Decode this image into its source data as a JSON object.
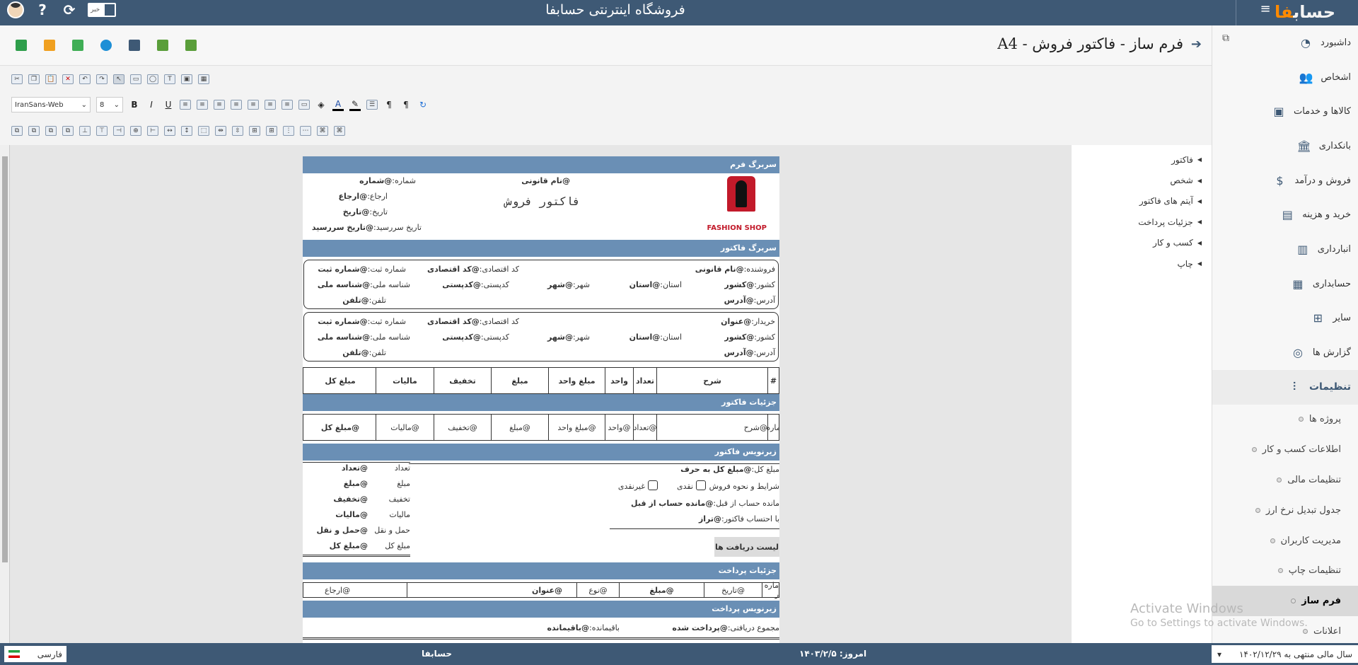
{
  "topbar": {
    "title": "فروشگاه اینترنتی حسابفا",
    "logo": "حساب",
    "logo_accent": "فا",
    "news_label": "خبر"
  },
  "sidebar": {
    "items": [
      {
        "label": "داشبورد",
        "icon": "gauge-icon"
      },
      {
        "label": "اشخاص",
        "icon": "people-icon"
      },
      {
        "label": "کالاها و خدمات",
        "icon": "box-icon"
      },
      {
        "label": "بانکداری",
        "icon": "bank-icon"
      },
      {
        "label": "فروش و درآمد",
        "icon": "sales-icon"
      },
      {
        "label": "خرید و هزینه",
        "icon": "cart-icon"
      },
      {
        "label": "انبارداری",
        "icon": "warehouse-icon"
      },
      {
        "label": "حسابداری",
        "icon": "ledger-icon"
      },
      {
        "label": "سایر",
        "icon": "grid-icon"
      },
      {
        "label": "گزارش ها",
        "icon": "report-icon"
      }
    ],
    "settings_label": "تنظیمات",
    "sub_items": [
      "پروژه ها",
      "اطلاعات کسب و کار",
      "تنظیمات مالی",
      "جدول تبدیل نرخ ارز",
      "مدیریت کاربران",
      "تنظیمات چاپ",
      "فرم ساز",
      "اعلانات"
    ],
    "active_sub": "فرم ساز"
  },
  "page": {
    "title": "فرم ساز - فاکتور فروش - A4"
  },
  "toolbar": {
    "font": "IranSans-Web",
    "size": "8"
  },
  "tree": [
    "فاکتور",
    "شخص",
    "آیتم های فاکتور",
    "جزئیات پرداخت",
    "کسب و کار",
    "چاپ"
  ],
  "form": {
    "band_form_header": "سربرگ فرم",
    "legal_name": "@نام قانونی",
    "doc_title": "فاکتور فروش",
    "logo_text": "FASHION SHOP",
    "hdr_fields": [
      {
        "k": "شماره:",
        "v": "@شماره"
      },
      {
        "k": "ارجاع:",
        "v": "@ارجاع"
      },
      {
        "k": "تاریخ:",
        "v": "@تاریخ"
      },
      {
        "k": "تاریخ سررسید:",
        "v": "@تاریخ سررسید"
      }
    ],
    "band_invoice_header": "سربرگ فاکتور",
    "seller": {
      "label": "فروشنده:",
      "name": "@نام قانونی",
      "eco": "کد اقتصادی:",
      "eco_v": "@کد اقتصادی",
      "reg": "شماره ثبت:",
      "reg_v": "@شماره ثبت",
      "country": "کشور:",
      "country_v": "@کشور",
      "state": "استان:",
      "state_v": "@استان",
      "city": "شهر:",
      "city_v": "@شهر",
      "postal": "کدپستی:",
      "postal_v": "@کدپستی",
      "nid": "شناسه ملی:",
      "nid_v": "@شناسه ملی",
      "addr": "آدرس:",
      "addr_v": "@آدرس",
      "tel": "تلفن:",
      "tel_v": "@تلفن"
    },
    "buyer": {
      "label": "خریدار:",
      "name": "@عنوان"
    },
    "cols": [
      "#",
      "شرح",
      "تعداد",
      "واحد",
      "مبلغ واحد",
      "مبلغ",
      "تخفیف",
      "مالیات",
      "مبلغ کل"
    ],
    "band_details": "جزئیات فاکتور",
    "detail_cells": [
      "ماره",
      "@شرح",
      "@تعداد",
      "@واحد",
      "@مبلغ واحد",
      "@مبلغ",
      "@تخفیف",
      "@مالیات",
      "@مبلغ کل"
    ],
    "band_footer": "زیرنویس فاکتور",
    "totals": [
      {
        "k": "تعداد",
        "v": "@تعداد"
      },
      {
        "k": "مبلغ",
        "v": "@مبلغ"
      },
      {
        "k": "تخفیف",
        "v": "@تخفیف"
      },
      {
        "k": "مالیات",
        "v": "@مالیات"
      },
      {
        "k": "حمل و نقل",
        "v": "@حمل و نقل"
      },
      {
        "k": "مبلغ کل",
        "v": "@مبلغ کل"
      }
    ],
    "sum_words_k": "مبلغ کل:",
    "sum_words_v": "@مبلغ کل به حرف",
    "terms": "شرایط و نحوه فروش",
    "cash": "نقدی",
    "noncash": "غیرنقدی",
    "prev_k": "مانده حساب از قبل:",
    "prev_v": "@مانده حساب از قبل",
    "bal_k": "با احتساب فاکتور:",
    "bal_v": "@تراز",
    "receipts_btn": "لیست دریافت ها",
    "band_payment": "جزئیات پرداخت",
    "pay_cells": [
      "ماره ر",
      "@تاریخ",
      "@مبلغ",
      "@نوع",
      "@عنوان",
      "@ارجاع"
    ],
    "band_pay_footer": "زیرنویس پرداخت",
    "recv_k": "مجموع دریافتی:",
    "recv_v": "@پرداخت شده",
    "rem_k": "باقیمانده:",
    "rem_v": "@باقیمانده"
  },
  "watermark": {
    "line1": "Activate Windows",
    "line2": "Go to Settings to activate Windows."
  },
  "footer": {
    "lang": "فارسی",
    "app": "حسابفا",
    "today_label": "امروز:",
    "today": "۱۴۰۳/۲/۵",
    "fiscal": "سال مالی منتهی به ۱۴۰۲/۱۲/۲۹"
  }
}
